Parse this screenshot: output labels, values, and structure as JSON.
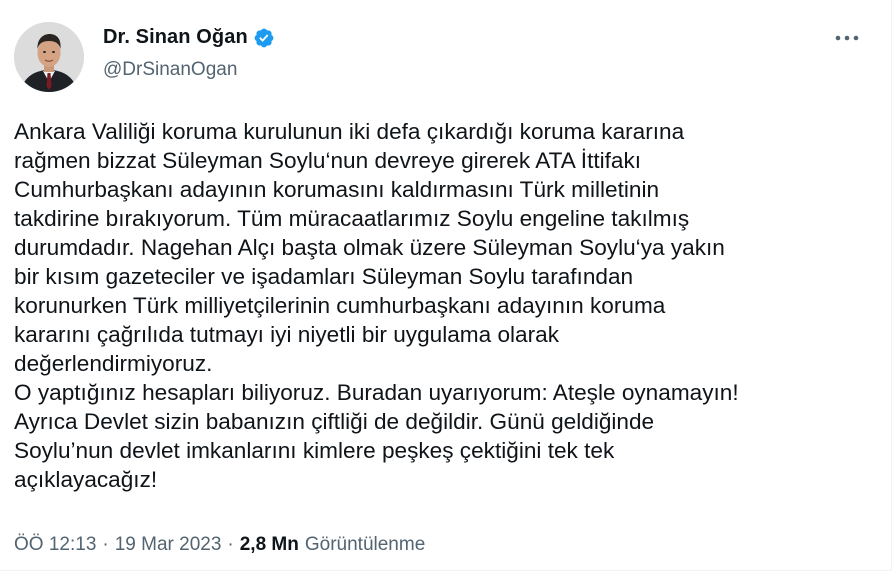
{
  "author": {
    "display_name": "Dr. Sinan Oğan",
    "handle": "@DrSinanOgan",
    "verified_icon": "verified-badge-icon",
    "accent_color": "#1d9bf0"
  },
  "tweet": {
    "text": "Ankara Valiliği koruma kurulunun iki defa çıkardığı koruma kararına\nrağmen bizzat Süleyman Soylu‘nun devreye girerek ATA İttifakı\nCumhurbaşkanı adayının korumasını kaldırmasını Türk milletinin\ntakdirine bırakıyorum. Tüm müracaatlarımız Soylu engeline takılmış\ndurumdadır. Nagehan Alçı başta olmak üzere Süleyman Soylu‘ya yakın\nbir kısım gazeteciler ve işadamları Süleyman Soylu tarafından\nkorunurken Türk milliyetçilerinin cumhurbaşkanı adayının koruma\nkararını çağrılıda tutmayı iyi niyetli bir uygulama olarak\ndeğerlendirmiyoruz.\nO yaptığınız hesapları biliyoruz. Buradan uyarıyorum: Ateşle oynamayın!\nAyrıca Devlet sizin babanızın çiftliği de değildir. Günü geldiğinde\nSoylu’nun devlet imkanlarını kimlere peşkeş çektiğini tek tek\naçıklayacağız!",
    "time": "ÖÖ 12:13",
    "separator": "·",
    "date": "19 Mar 2023",
    "views_count": "2,8 Mn",
    "views_label": "Görüntülenme"
  },
  "icons": {
    "more": "more-options-icon",
    "avatar": "profile-avatar"
  }
}
